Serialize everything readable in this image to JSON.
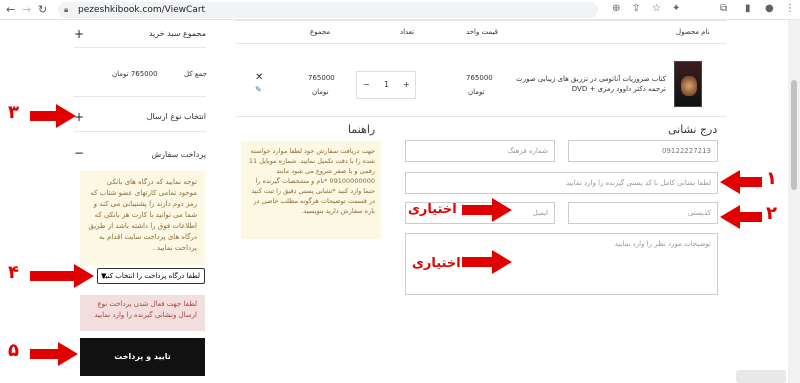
{
  "browser": {
    "url": "pezeshkibook.com/ViewCart"
  },
  "sidebar": {
    "cart_total_title": "مجموع سبد خرید",
    "total_label": "جمع کل",
    "total_value": "765000 تومان",
    "shipping_title": "انتخاب نوع ارسال",
    "payment_title": "پرداخت سفارش",
    "payment_notice": "توجه نمایید که درگاه های بانکی موجود تمامی کارتهای عضو شتاب که رمز دوم دارند را پشتیبانی می کند و شما می توانید با کارت هر بانکی که اطلاعات فوق را داشته باشد از طریق درگاه های پرداخت سایت اقدام به پرداخت نمایید .",
    "gateway_select": "لطفا درگاه پرداخت را انتخاب کنید",
    "error_notice": "لطفا جهت فعال شدن پرداخت نوع ارسال ونشانی گیرنده را وارد نمایید",
    "confirm_button": "تایید و پرداخت"
  },
  "cart_table": {
    "headers": [
      "نام محصول",
      "قیمت واحد",
      "تعداد",
      "مجموع"
    ],
    "row": {
      "product_name": "کتاب ضروریات آناتومی در تزریق های زیبایی صورت ترجمه دکتر داوود رمزی + DVD",
      "unit_price": "765000",
      "unit_price_currency": "تومان",
      "quantity": "1",
      "total": "765000",
      "total_currency": "تومان"
    }
  },
  "address_section": {
    "title": "درج نشانی",
    "phone_value": "09122227213",
    "city_placeholder": "شماره فرهنگ",
    "address_placeholder": "لطفا نشانی کامل با کد پستی گیرنده را وارد نمایید",
    "postal_placeholder": "کدپستی",
    "email_placeholder": "ایمیل",
    "notes_placeholder": "توضیحات مورد نظر را وارد نمایید"
  },
  "guide_section": {
    "title": "راهنما",
    "text": "جهت دریافت سفارش خود لطفا موارد خواسته شده را با دقت تکمیل نمایید. شماره موبایل 11 رقمی و با صفر شروع می شود مانند 09100000000 *نام و مشخصات گیرنده را حتما وارد کنید *نشانی پستی دقیق را ثبت کنید در قسمت توضیحات هرگونه مطلب خاصی در باره سفارش دارید بنویسید."
  },
  "annotations": {
    "optional_1": "اختیاری",
    "optional_2": "اختیاری",
    "num_1": "١",
    "num_2": "٢",
    "num_3": "٣",
    "num_4": "۴",
    "num_5": "۵"
  },
  "colors": {
    "arrow": "#e00000",
    "warn_bg": "#fcf8e3",
    "error_bg": "#f2dede",
    "button_bg": "#111111"
  }
}
